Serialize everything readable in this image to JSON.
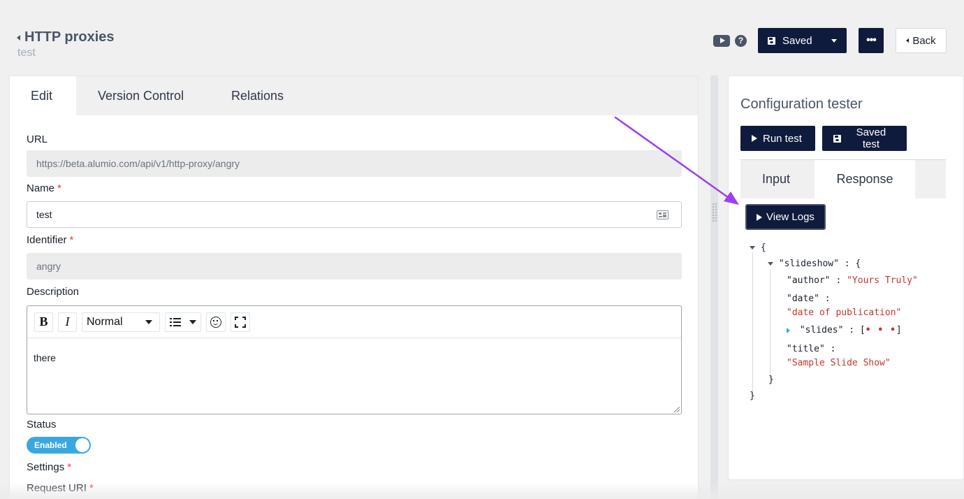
{
  "header": {
    "title": "HTTP proxies",
    "subtitle": "test",
    "saved_label": "Saved",
    "more_label": "•••",
    "back_label": "Back",
    "help_label": "?"
  },
  "tabs": [
    "Edit",
    "Version Control",
    "Relations"
  ],
  "form": {
    "url_label": "URL",
    "url_value": "https://beta.alumio.com/api/v1/http-proxy/angry",
    "name_label": "Name",
    "name_value": "test",
    "identifier_label": "Identifier",
    "identifier_value": "angry",
    "description_label": "Description",
    "editor_format": "Normal",
    "editor_content": "there",
    "status_label": "Status",
    "status_value": "Enabled",
    "settings_label": "Settings",
    "request_uri_label": "Request URI",
    "required_mark": "*"
  },
  "tester": {
    "title": "Configuration tester",
    "run_label": "Run test",
    "saved_test_label": "Saved test",
    "tabs": [
      "Input",
      "Response"
    ],
    "active_tab": "Response",
    "view_logs_label": "View Logs"
  },
  "json_tree": {
    "open_brace": "{",
    "close_brace": "}",
    "slideshow_key": "\"slideshow\"",
    "author_key": "\"author\"",
    "author_value": "\"Yours Truly\"",
    "date_key": "\"date\"",
    "date_value": "\"date of publication\"",
    "slides_key": "\"slides\"",
    "slides_collapsed": "• • •",
    "title_key": "\"title\"",
    "title_value": "\"Sample Slide Show\"",
    "colon": ":"
  },
  "colors": {
    "primary": "#0f1b3d",
    "toggle": "#3aa8e0",
    "required": "#e53e3e",
    "json_string": "#c0392b",
    "annotation_arrow": "#9b3ff0"
  }
}
